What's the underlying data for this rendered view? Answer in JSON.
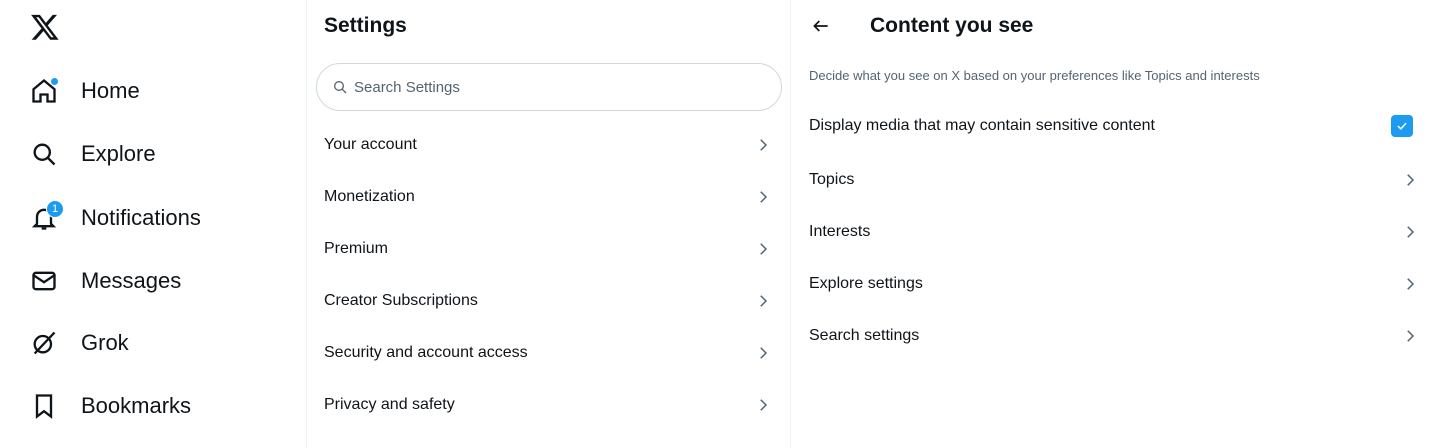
{
  "nav": {
    "logo_icon": "x-logo-icon",
    "items": [
      {
        "label": "Home",
        "icon": "home-icon",
        "has_dot": true
      },
      {
        "label": "Explore",
        "icon": "search-icon"
      },
      {
        "label": "Notifications",
        "icon": "bell-icon",
        "badge": "1"
      },
      {
        "label": "Messages",
        "icon": "mail-icon"
      },
      {
        "label": "Grok",
        "icon": "grok-icon"
      },
      {
        "label": "Bookmarks",
        "icon": "bookmark-icon"
      }
    ]
  },
  "settings": {
    "title": "Settings",
    "search_placeholder": "Search Settings",
    "search_value": "",
    "items": [
      {
        "label": "Your account"
      },
      {
        "label": "Monetization"
      },
      {
        "label": "Premium"
      },
      {
        "label": "Creator Subscriptions"
      },
      {
        "label": "Security and account access"
      },
      {
        "label": "Privacy and safety"
      }
    ]
  },
  "content": {
    "title": "Content you see",
    "description": "Decide what you see on X based on your preferences like Topics and interests",
    "sensitive_label": "Display media that may contain sensitive content",
    "sensitive_checked": true,
    "items": [
      {
        "label": "Topics"
      },
      {
        "label": "Interests"
      },
      {
        "label": "Explore settings"
      },
      {
        "label": "Search settings"
      }
    ]
  },
  "colors": {
    "accent": "#1d9bf0",
    "text": "#0f1419",
    "muted": "#536471",
    "border": "#cfd9de"
  }
}
